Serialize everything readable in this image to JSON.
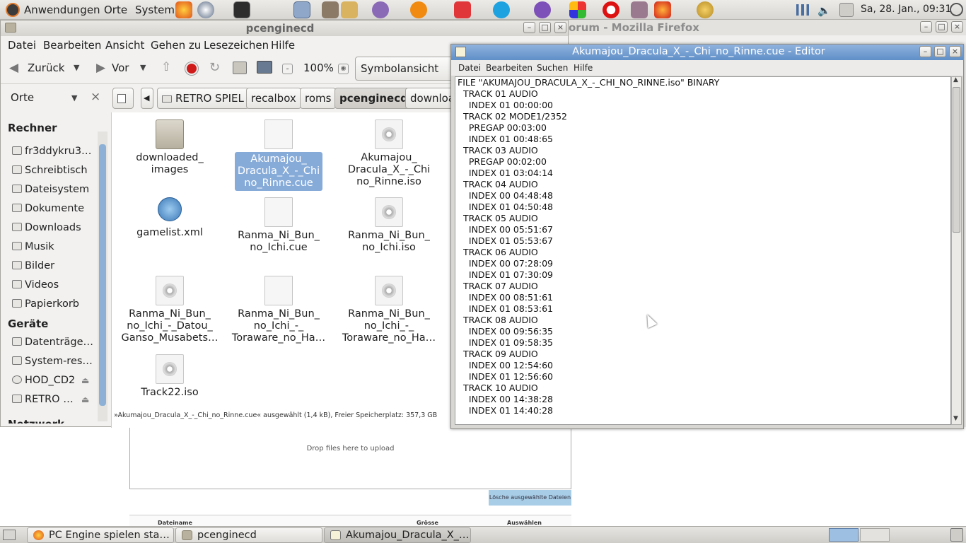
{
  "top_panel": {
    "menus": [
      "Anwendungen",
      "Orte",
      "System"
    ],
    "clock": "Sa, 28. Jan., 09:31",
    "launchers": [
      "firefox-icon",
      "chromium-icon",
      "terminal-icon",
      "calculator-icon",
      "gimp-icon",
      "files-icon",
      "pidgin-icon",
      "game-icon",
      "vivaldi-icon",
      "skype-icon",
      "viber-icon",
      "picasa-icon",
      "opera-icon",
      "archive-icon",
      "burn-icon",
      "globe-icon"
    ]
  },
  "firefox": {
    "title": "orum - Mozilla Firefox",
    "drop_text": "Drop files here to upload",
    "delete_button": "Lösche ausgewählte Dateien",
    "col_name": "Dateiname",
    "col_size": "Grösse",
    "col_select": "Auswählen"
  },
  "nautilus": {
    "title": "pcenginecd",
    "menu": [
      "Datei",
      "Bearbeiten",
      "Ansicht",
      "Gehen zu",
      "Lesezeichen",
      "Hilfe"
    ],
    "back": "Zurück",
    "forward": "Vor",
    "zoom": "100%",
    "view_mode": "Symbolansicht",
    "places_label": "Orte",
    "breadcrumbs": [
      "RETRO SPIEL",
      "recalbox",
      "roms",
      "pcenginecd",
      "downloa"
    ],
    "sidebar": {
      "computer_heading": "Rechner",
      "computer_items": [
        "fr3ddykru3…",
        "Schreibtisch",
        "Dateisystem",
        "Dokumente",
        "Downloads",
        "Musik",
        "Bilder",
        "Videos",
        "Papierkorb"
      ],
      "devices_heading": "Geräte",
      "device_items": [
        "Datenträge…",
        "System-rese…",
        "HOD_CD2",
        "RETRO …"
      ],
      "network_heading": "Netzwerk"
    },
    "files": [
      {
        "name": "downloaded_\nimages",
        "type": "folder",
        "selected": false
      },
      {
        "name": "Akumajou_\nDracula_X_-_Chi\nno_Rinne.cue",
        "type": "doc",
        "selected": true
      },
      {
        "name": "Akumajou_\nDracula_X_-_Chi\nno_Rinne.iso",
        "type": "disc",
        "selected": false
      },
      {
        "name": "gamelist.xml",
        "type": "web",
        "selected": false
      },
      {
        "name": "Ranma_Ni_Bun_\nno_Ichi.cue",
        "type": "doc",
        "selected": false
      },
      {
        "name": "Ranma_Ni_Bun_\nno_Ichi.iso",
        "type": "disc",
        "selected": false
      },
      {
        "name": "Ranma_Ni_Bun_\nno_Ichi_-_Datou_\nGanso_Musabets…",
        "type": "disc",
        "selected": false
      },
      {
        "name": "Ranma_Ni_Bun_\nno_Ichi_-_\nToraware_no_Ha…",
        "type": "doc",
        "selected": false
      },
      {
        "name": "Ranma_Ni_Bun_\nno_Ichi_-_\nToraware_no_Ha…",
        "type": "disc",
        "selected": false
      },
      {
        "name": "Track22.iso",
        "type": "disc",
        "selected": false
      }
    ],
    "status": "»Akumajou_Dracula_X_-_Chi_no_Rinne.cue« ausgewählt (1,4 kB), Freier Speicherplatz: 357,3 GB"
  },
  "editor": {
    "title": "Akumajou_Dracula_X_-_Chi_no_Rinne.cue - Editor",
    "menu": [
      "Datei",
      "Bearbeiten",
      "Suchen",
      "Hilfe"
    ],
    "lines": [
      "FILE \"AKUMAJOU_DRACULA_X_-_CHI_NO_RINNE.iso\" BINARY",
      "  TRACK 01 AUDIO",
      "    INDEX 01 00:00:00",
      "  TRACK 02 MODE1/2352",
      "    PREGAP 00:03:00",
      "    INDEX 01 00:48:65",
      "  TRACK 03 AUDIO",
      "    PREGAP 00:02:00",
      "    INDEX 01 03:04:14",
      "  TRACK 04 AUDIO",
      "    INDEX 00 04:48:48",
      "    INDEX 01 04:50:48",
      "  TRACK 05 AUDIO",
      "    INDEX 00 05:51:67",
      "    INDEX 01 05:53:67",
      "  TRACK 06 AUDIO",
      "    INDEX 00 07:28:09",
      "    INDEX 01 07:30:09",
      "  TRACK 07 AUDIO",
      "    INDEX 00 08:51:61",
      "    INDEX 01 08:53:61",
      "  TRACK 08 AUDIO",
      "    INDEX 00 09:56:35",
      "    INDEX 01 09:58:35",
      "  TRACK 09 AUDIO",
      "    INDEX 00 12:54:60",
      "    INDEX 01 12:56:60",
      "  TRACK 10 AUDIO",
      "    INDEX 00 14:38:28",
      "    INDEX 01 14:40:28"
    ]
  },
  "taskbar": {
    "tasks": [
      "PC Engine spielen star…",
      "pcenginecd",
      "Akumajou_Dracula_X_…"
    ]
  }
}
